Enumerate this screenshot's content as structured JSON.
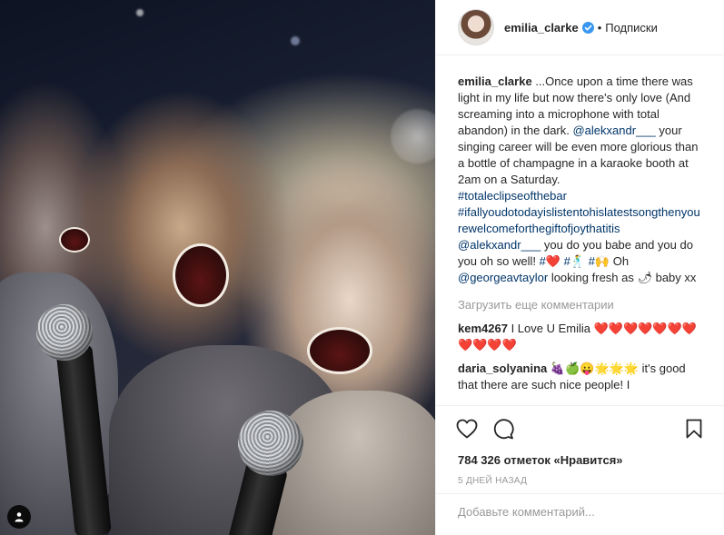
{
  "header": {
    "username": "emilia_clarke",
    "follow_label": "Подписки"
  },
  "caption": {
    "username": "emilia_clarke",
    "text_part1": "...Once upon a time there was light in my life but now there's only love (And screaming into a microphone with total abandon) in the dark. ",
    "mention1": "@alekxandr___",
    "text_part2": " your singing career will be even more glorious than a bottle of champagne in a karaoke booth at 2am on a Saturday. ",
    "hashtag1": "#totaleclipseofthebar",
    "hashtag2": "#ifallyoudotodayislistentohislatestsongthenyourewelcomeforthegiftofjoythatitis",
    "mention2": "@alekxandr___",
    "text_part3": " you do you babe and you do you oh so well! ",
    "hashtag3": "#❤️",
    "text_part4": " ",
    "hashtag4": "#🕺",
    "text_part5": " ",
    "hashtag5": "#🙌",
    "text_part6": " Oh ",
    "mention3": "@georgeavtaylor",
    "text_part7": " looking fresh as 🌶 baby xx"
  },
  "load_more_label": "Загрузить еще комментарии",
  "comments": [
    {
      "username": "kem4267",
      "text": "I Love U Emilia ❤️❤️❤️❤️❤️❤️❤️❤️❤️❤️❤️"
    },
    {
      "username": "daria_solyanina",
      "text": "🍇🍏😛🌟🌟🌟 it's good that there are such nice people! I"
    }
  ],
  "actions": {
    "likes_text": "784 326 отметок «Нравится»",
    "date_text": "5 дней назад"
  },
  "add_comment": {
    "placeholder": "Добавьте комментарий..."
  },
  "icons": {
    "verified": "verified-badge-icon",
    "like": "heart-icon",
    "comment": "speech-bubble-icon",
    "save": "bookmark-icon",
    "tagged": "person-tag-icon"
  },
  "colors": {
    "link": "#003569",
    "verified": "#3897f0",
    "muted": "#999999"
  }
}
